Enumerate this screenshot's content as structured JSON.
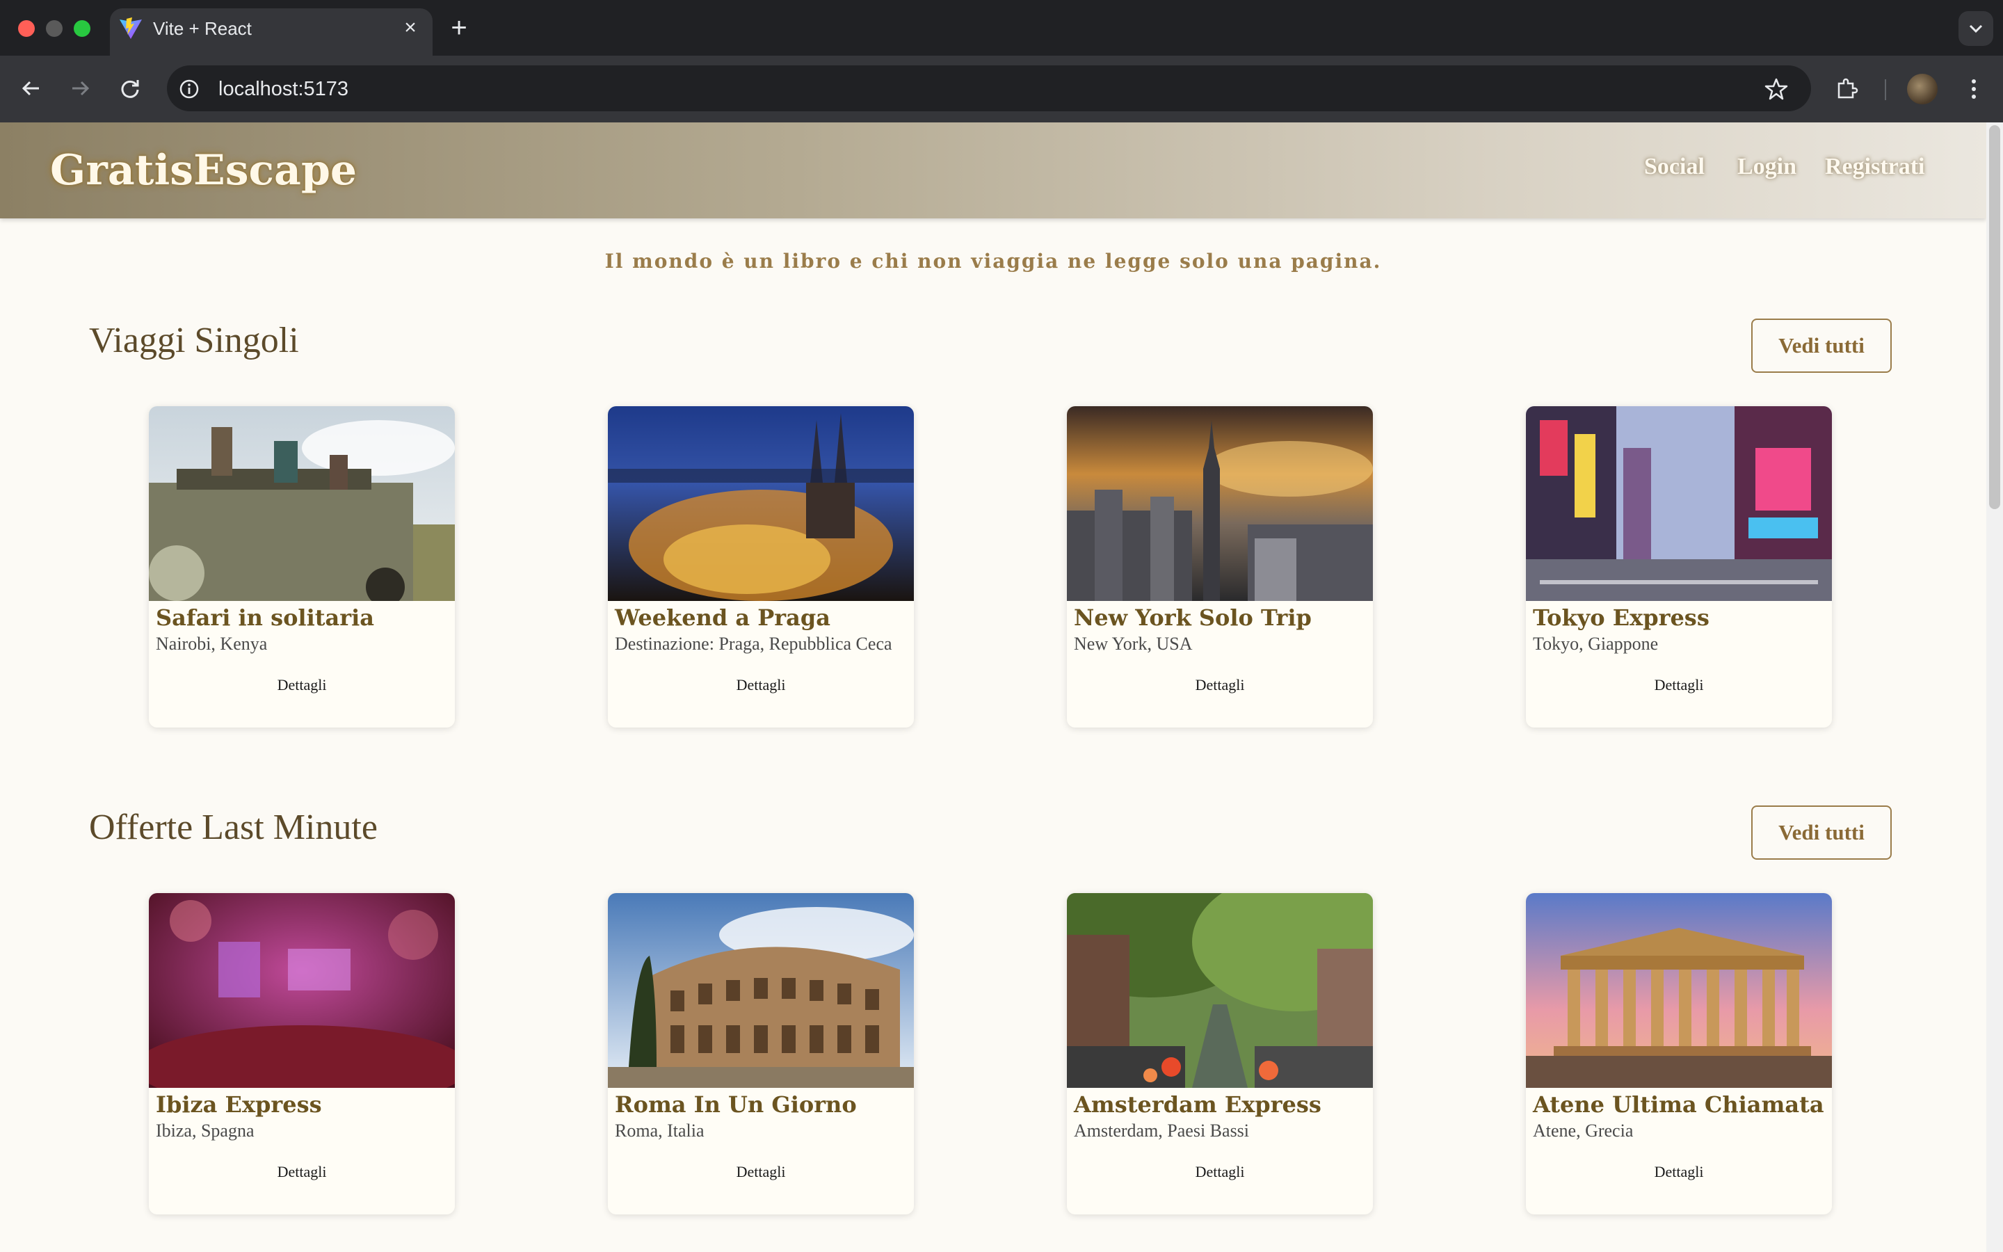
{
  "browser": {
    "tab_title": "Vite + React",
    "url": "localhost:5173"
  },
  "site": {
    "logo": "GratisEscape",
    "nav": [
      "Social",
      "Login",
      "Registrati"
    ],
    "quote": "Il mondo è un libro e chi non viaggia ne legge solo una pagina."
  },
  "sections": [
    {
      "title": "Viaggi Singoli",
      "see_all": "Vedi tutti",
      "cards": [
        {
          "title": "Safari in solitaria",
          "location": "Nairobi, Kenya",
          "button": "Dettagli",
          "image": "safari-jeep-photo"
        },
        {
          "title": "Weekend a Praga",
          "location": "Destinazione: Praga, Repubblica Ceca",
          "button": "Dettagli",
          "image": "prague-night-photo"
        },
        {
          "title": "New York Solo Trip",
          "location": "New York, USA",
          "button": "Dettagli",
          "image": "new-york-skyline-photo"
        },
        {
          "title": "Tokyo Express",
          "location": "Tokyo, Giappone",
          "button": "Dettagli",
          "image": "tokyo-street-photo"
        }
      ]
    },
    {
      "title": "Offerte Last Minute",
      "see_all": "Vedi tutti",
      "cards": [
        {
          "title": "Ibiza Express",
          "location": "Ibiza, Spagna",
          "button": "Dettagli",
          "image": "ibiza-party-photo"
        },
        {
          "title": "Roma In Un Giorno",
          "location": "Roma, Italia",
          "button": "Dettagli",
          "image": "colosseum-photo"
        },
        {
          "title": "Amsterdam Express",
          "location": "Amsterdam, Paesi Bassi",
          "button": "Dettagli",
          "image": "amsterdam-canal-photo"
        },
        {
          "title": "Atene Ultima Chiamata",
          "location": "Atene, Grecia",
          "button": "Dettagli",
          "image": "parthenon-photo"
        }
      ]
    }
  ]
}
